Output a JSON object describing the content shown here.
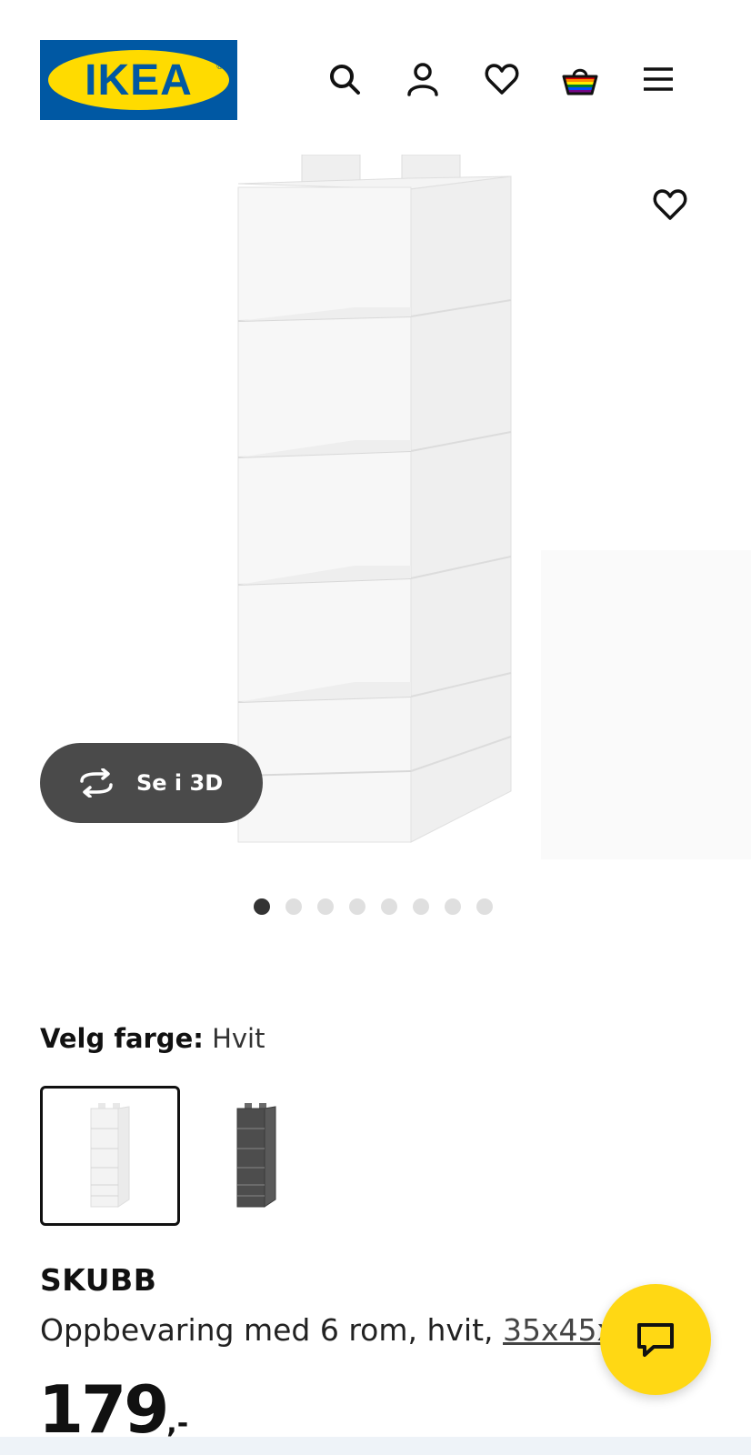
{
  "header": {
    "logo_text": "IKEA",
    "logo_registered": "®",
    "brand_colors": {
      "blue": "#0058a3",
      "yellow": "#ffdb00"
    },
    "icons": [
      "search-icon",
      "account-icon",
      "favourites-icon",
      "shopping-bag-icon",
      "menu-icon"
    ]
  },
  "gallery": {
    "view_3d_label": "Se i 3D",
    "image_count": 8,
    "active_image": 1
  },
  "color": {
    "label": "Velg farge:",
    "selected": "Hvit",
    "options": [
      "white",
      "dark grey"
    ]
  },
  "product": {
    "name": "SKUBB",
    "description": "Oppbevaring med 6 rom, hvit, ",
    "dimensions": "35x45x",
    "price": "179",
    "price_suffix": ",-"
  },
  "chat": {
    "accent": "#ffd814"
  }
}
